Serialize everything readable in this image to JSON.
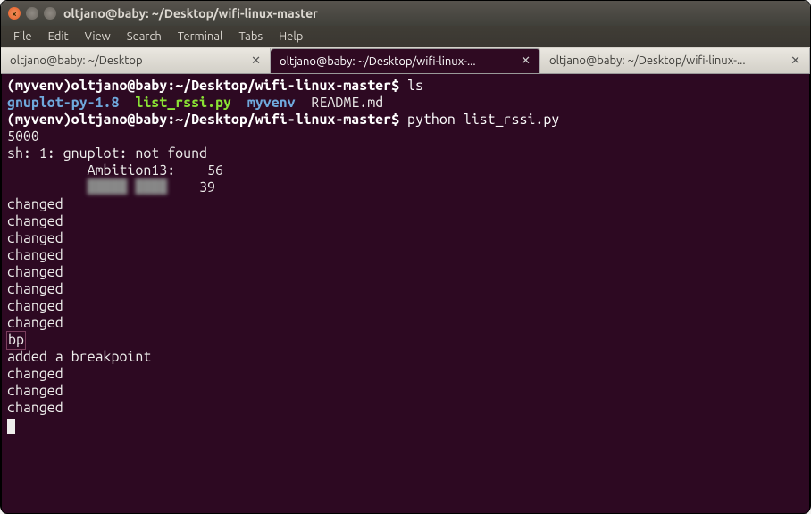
{
  "window": {
    "title": "oltjano@baby: ~/Desktop/wifi-linux-master",
    "close_sym": "×",
    "min_sym": "−",
    "max_sym": "□"
  },
  "menu": {
    "items": [
      "File",
      "Edit",
      "View",
      "Search",
      "Terminal",
      "Tabs",
      "Help"
    ]
  },
  "tabs": [
    {
      "label": "oltjano@baby: ~/Desktop",
      "active": false
    },
    {
      "label": "oltjano@baby: ~/Desktop/wifi-linux-...",
      "active": true
    },
    {
      "label": "oltjano@baby: ~/Desktop/wifi-linux-...",
      "active": false
    }
  ],
  "close_x": "✕",
  "term": {
    "prompt": "(myvenv)oltjano@baby:~/Desktop/wifi-linux-master$",
    "cmd_ls": "ls",
    "ls": {
      "dir1": "gnuplot-py-1.8",
      "exe1": "list_rssi.py",
      "dir2": "myvenv",
      "file1": "README.md"
    },
    "cmd_py": "python list_rssi.py",
    "out_5000": "5000",
    "out_sh": "sh: 1: gnuplot: not found",
    "net1_name": "Ambition13:",
    "net1_val": "56",
    "net2_name": "█████ ████",
    "net2_val": "39",
    "changed": "changed",
    "bp": "bp",
    "added_bp": "added a breakpoint"
  }
}
